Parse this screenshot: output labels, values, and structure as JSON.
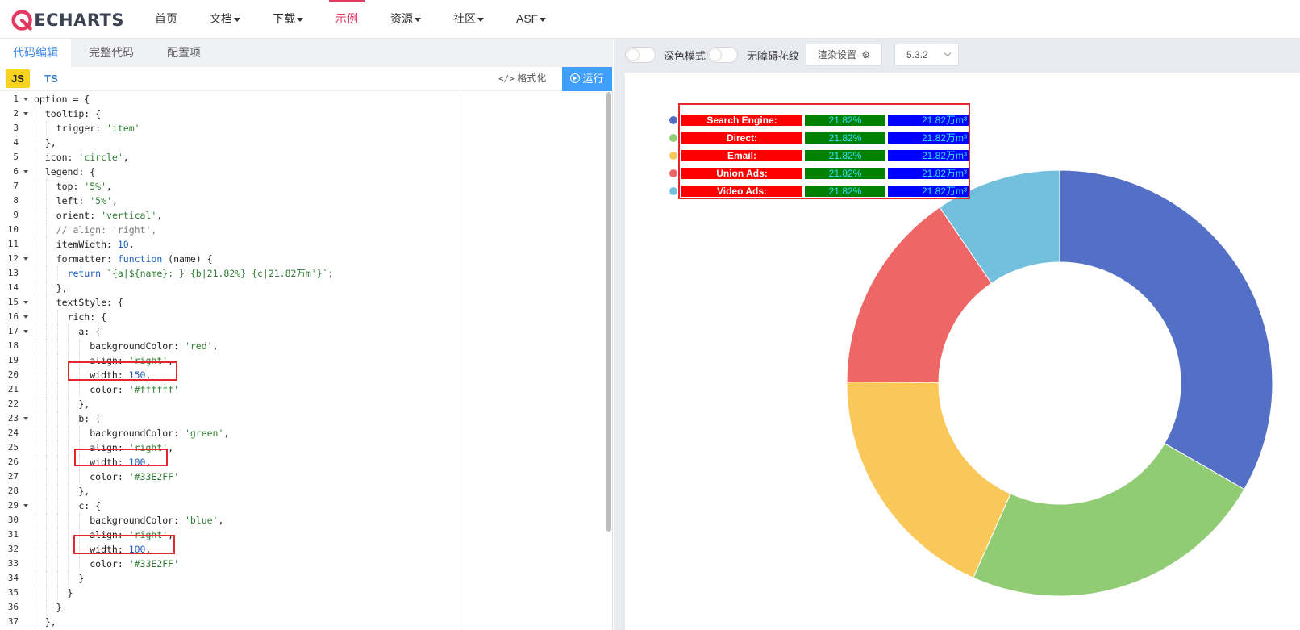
{
  "header": {
    "logo_text": "ECHARTS",
    "nav": [
      {
        "label": "首页",
        "dropdown": false,
        "active": false
      },
      {
        "label": "文档",
        "dropdown": true,
        "active": false
      },
      {
        "label": "下载",
        "dropdown": true,
        "active": false
      },
      {
        "label": "示例",
        "dropdown": false,
        "active": true
      },
      {
        "label": "资源",
        "dropdown": true,
        "active": false
      },
      {
        "label": "社区",
        "dropdown": true,
        "active": false
      },
      {
        "label": "ASF",
        "dropdown": true,
        "active": false
      }
    ],
    "accent_color": "#e43961"
  },
  "editor": {
    "tabs": [
      "代码编辑",
      "完整代码",
      "配置项"
    ],
    "lang_js": "JS",
    "lang_ts": "TS",
    "format_label": "格式化",
    "run_label": "运行",
    "lines": [
      "option = {",
      "  tooltip: {",
      "    trigger: 'item'",
      "  },",
      "  icon: 'circle',",
      "  legend: {",
      "    top: '5%',",
      "    left: '5%',",
      "    orient: 'vertical',",
      "    // align: 'right',",
      "    itemWidth: 10,",
      "    formatter: function (name) {",
      "      return `{a|${name}: } {b|21.82%} {c|21.82万m³}`;",
      "    },",
      "    textStyle: {",
      "      rich: {",
      "        a: {",
      "          backgroundColor: 'red',",
      "          align: 'right',",
      "          width: 150,",
      "          color: '#ffffff'",
      "        },",
      "        b: {",
      "          backgroundColor: 'green',",
      "          align: 'right',",
      "          width: 100,",
      "          color: '#33E2FF'",
      "        },",
      "        c: {",
      "          backgroundColor: 'blue',",
      "          align: 'right',",
      "          width: 100,",
      "          color: '#33E2FF'",
      "        }",
      "      }",
      "    }",
      "  },"
    ]
  },
  "preview": {
    "dark_mode_label": "深色模式",
    "a11y_label": "无障碍花纹",
    "render_settings_label": "渲染设置",
    "version": "5.3.2"
  },
  "chart_data": {
    "type": "pie",
    "donut": true,
    "legend_placement": "top-left",
    "legend_text_b": "21.82%",
    "legend_text_c": "21.82万m³",
    "series": [
      {
        "name": "Search Engine",
        "value": 1048,
        "color": "#5470c6"
      },
      {
        "name": "Direct",
        "value": 735,
        "color": "#91cc75"
      },
      {
        "name": "Email",
        "value": 580,
        "color": "#fac858"
      },
      {
        "name": "Union Ads",
        "value": 484,
        "color": "#ee6666"
      },
      {
        "name": "Video Ads",
        "value": 300,
        "color": "#73c0de"
      }
    ],
    "rich_colors": {
      "a_bg": "#ff0000",
      "a_fg": "#ffffff",
      "b_bg": "#008000",
      "b_fg": "#33E2FF",
      "c_bg": "#0000ff",
      "c_fg": "#33E2FF"
    }
  }
}
